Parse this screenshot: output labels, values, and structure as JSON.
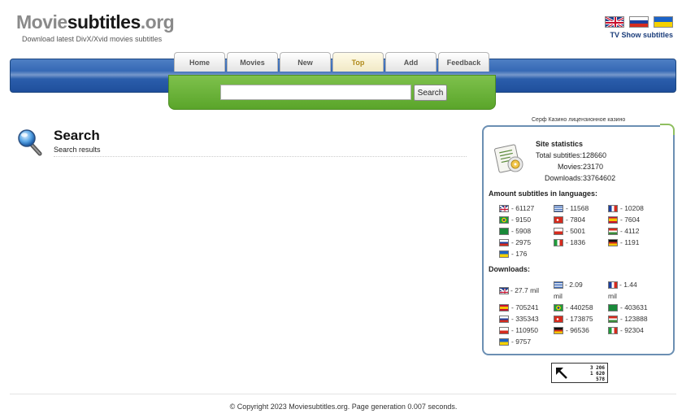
{
  "header": {
    "logo_a": "Movie",
    "logo_b": "subtitles",
    "logo_c": ".org",
    "tagline": "Download latest DivX/Xvid movies subtitles",
    "tvshow_link": "TV Show subtitles",
    "flags": [
      "uk-flag-icon",
      "russia-flag-icon",
      "ukraine-flag-icon"
    ]
  },
  "nav": {
    "tabs": [
      {
        "label": "Home",
        "active": false
      },
      {
        "label": "Movies",
        "active": false
      },
      {
        "label": "New",
        "active": false
      },
      {
        "label": "Top",
        "active": true
      },
      {
        "label": "Add",
        "active": false
      },
      {
        "label": "Feedback",
        "active": false
      }
    ]
  },
  "search": {
    "value": "",
    "placeholder": "",
    "button_label": "Search"
  },
  "main": {
    "title": "Search",
    "subtitle": "Search results"
  },
  "sidebar": {
    "ad_link": "Серф Казино лицензионное казино",
    "stats_title": "Site statistics",
    "total_subtitles": "Total subtitles:128660",
    "movies": "Movies:23170",
    "downloads": "Downloads:33764602",
    "lang_heading": "Amount subtitles in languages:",
    "languages": [
      {
        "flag": "uk",
        "count": "- 61127"
      },
      {
        "flag": "gr",
        "count": "- 11568"
      },
      {
        "flag": "fr",
        "count": "- 10208"
      },
      {
        "flag": "br",
        "count": "- 9150"
      },
      {
        "flag": "tr",
        "count": "- 7804"
      },
      {
        "flag": "es",
        "count": "- 7604"
      },
      {
        "flag": "ar",
        "count": "- 5908"
      },
      {
        "flag": "pl",
        "count": "- 5001"
      },
      {
        "flag": "hu",
        "count": "- 4112"
      },
      {
        "flag": "ru",
        "count": "- 2975"
      },
      {
        "flag": "it",
        "count": "- 1836"
      },
      {
        "flag": "de",
        "count": "- 1191"
      },
      {
        "flag": "ua",
        "count": "- 176"
      }
    ],
    "downloads_heading": "Downloads:",
    "downloads_list": [
      {
        "flag": "uk",
        "count": "- 27.7 mil"
      },
      {
        "flag": "gr",
        "count": "- 2.09 mil"
      },
      {
        "flag": "fr",
        "count": "- 1.44 mil"
      },
      {
        "flag": "es",
        "count": "- 705241"
      },
      {
        "flag": "br",
        "count": "- 440258"
      },
      {
        "flag": "ar",
        "count": "- 403631"
      },
      {
        "flag": "ru",
        "count": "- 335343"
      },
      {
        "flag": "tr",
        "count": "- 173875"
      },
      {
        "flag": "hu",
        "count": "- 123888"
      },
      {
        "flag": "pl",
        "count": "- 110950"
      },
      {
        "flag": "de",
        "count": "- 96536"
      },
      {
        "flag": "it",
        "count": "- 92304"
      },
      {
        "flag": "ua",
        "count": "- 9757"
      }
    ]
  },
  "counter": {
    "line1": "3 206",
    "line2": "1 620",
    "line3": "578"
  },
  "footer": {
    "text": "© Copyright 2023 Moviesubtitles.org. Page generation 0.007 seconds."
  }
}
